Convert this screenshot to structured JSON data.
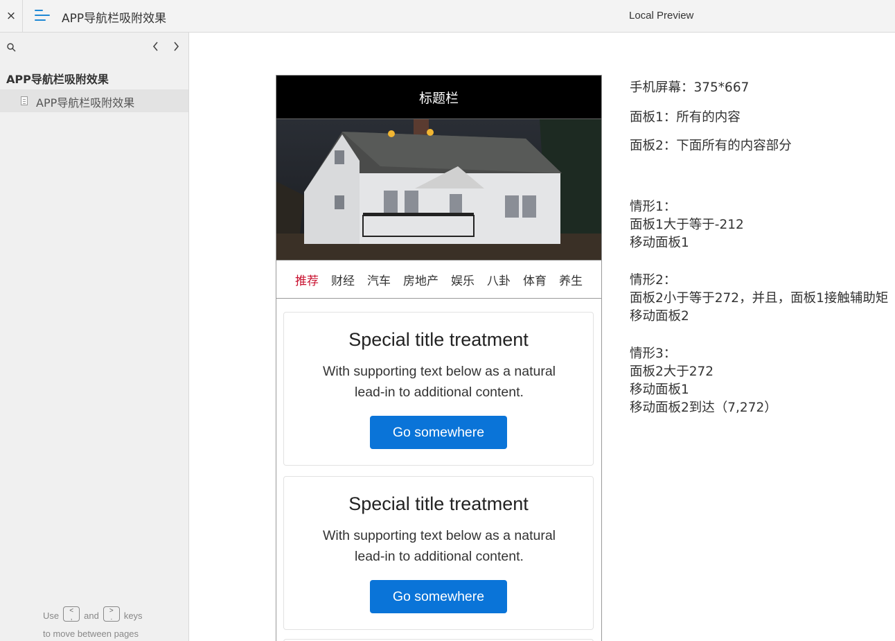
{
  "topbar": {
    "close_label": "×",
    "app_title": "APP导航栏吸附效果",
    "preview_label": "Local Preview",
    "accent_color": "#1e88d4"
  },
  "sidebar": {
    "search_icon": "search-icon",
    "prev_label": "‹",
    "next_label": "›",
    "tree_root": "APP导航栏吸附效果",
    "items": [
      {
        "label": "APP导航栏吸附效果",
        "icon": "page-icon",
        "selected": true
      }
    ],
    "hint": {
      "use": "Use",
      "prev_key": "<\n,",
      "and": "and",
      "next_key": ">\n.",
      "keys": "keys",
      "line2": "to move between pages"
    }
  },
  "phone": {
    "header_title": "标题栏",
    "tabs": [
      "推荐",
      "财经",
      "汽车",
      "房地产",
      "娱乐",
      "八卦",
      "体育",
      "养生"
    ],
    "active_tab_color": "#c8102e",
    "cards": [
      {
        "title": "Special title treatment",
        "text": "With supporting text below as a natural lead-in to additional content.",
        "button": "Go somewhere"
      },
      {
        "title": "Special title treatment",
        "text": "With supporting text below as a natural lead-in to additional content.",
        "button": "Go somewhere"
      }
    ],
    "button_color": "#0a74d8"
  },
  "notes": {
    "screen": "手机屏幕：375*667",
    "panel1": "面板1：所有的内容",
    "panel2": "面板2：下面所有的内容部分",
    "case1_title": "情形1：",
    "case1_line1": "面板1大于等于-212",
    "case1_line2": "移动面板1",
    "case2_title": "情形2：",
    "case2_line1": "面板2小于等于272，并且，面板1接触辅助矩",
    "case2_line2": "移动面板2",
    "case3_title": "情形3：",
    "case3_line1": "面板2大于272",
    "case3_line2": "移动面板1",
    "case3_line3": "移动面板2到达（7,272）"
  }
}
